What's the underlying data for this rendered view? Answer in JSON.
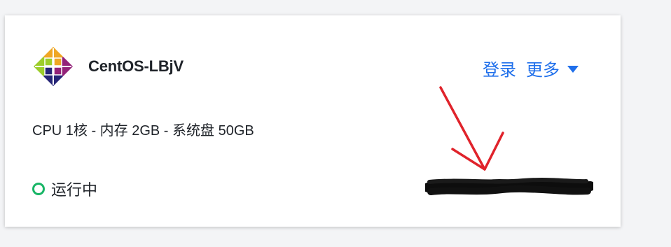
{
  "instance": {
    "name": "CentOS-LBjV",
    "logo_icon": "centos-logo",
    "spec": "CPU 1核 - 内存 2GB - 系统盘 50GB",
    "status": "运行中",
    "status_color": "#18b566"
  },
  "actions": {
    "login_label": "登录",
    "more_label": "更多",
    "accent_color": "#1f6feb"
  },
  "annotation": {
    "arrow_color": "#e0232b",
    "redaction": "scribbled-out ip text"
  }
}
